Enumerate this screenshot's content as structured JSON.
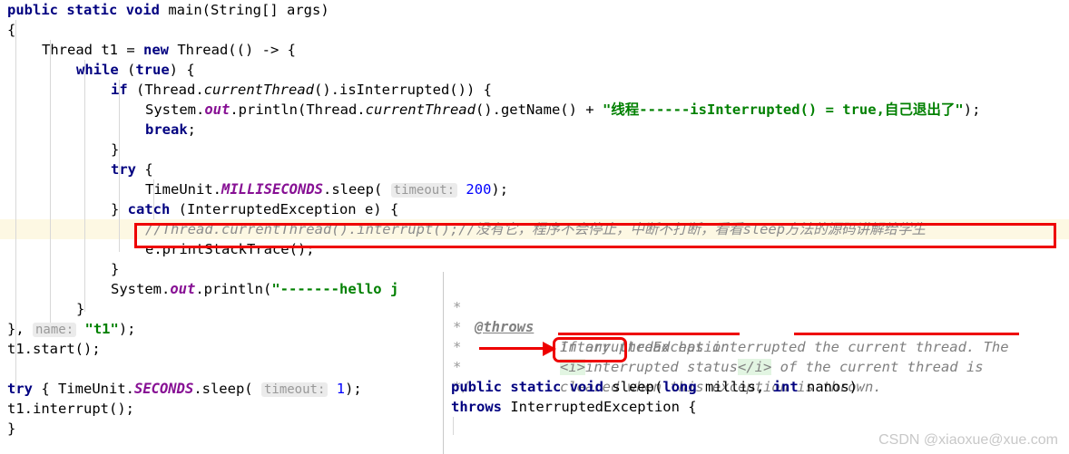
{
  "editor": {
    "language": "java",
    "caret_row_index": 11,
    "lines": [
      {
        "indent": 0,
        "segments": [
          {
            "t": "public",
            "c": "kw"
          },
          {
            "t": " ",
            "c": "plain"
          },
          {
            "t": "static",
            "c": "kw"
          },
          {
            "t": " ",
            "c": "plain"
          },
          {
            "t": "void",
            "c": "kw"
          },
          {
            "t": " main(String[] args)",
            "c": "plain"
          }
        ]
      },
      {
        "indent": 0,
        "segments": [
          {
            "t": "{",
            "c": "plain"
          }
        ]
      },
      {
        "indent": 1,
        "segments": [
          {
            "t": "Thread t1 = ",
            "c": "plain"
          },
          {
            "t": "new",
            "c": "kw"
          },
          {
            "t": " Thread(() -> {",
            "c": "plain"
          }
        ]
      },
      {
        "indent": 2,
        "segments": [
          {
            "t": "while",
            "c": "kw"
          },
          {
            "t": " (",
            "c": "plain"
          },
          {
            "t": "true",
            "c": "kw"
          },
          {
            "t": ") {",
            "c": "plain"
          }
        ]
      },
      {
        "indent": 3,
        "segments": [
          {
            "t": "if",
            "c": "kw"
          },
          {
            "t": " (Thread.",
            "c": "plain"
          },
          {
            "t": "currentThread",
            "c": "ital"
          },
          {
            "t": "().isInterrupted()) {",
            "c": "plain"
          }
        ]
      },
      {
        "indent": 4,
        "segments": [
          {
            "t": "System.",
            "c": "plain"
          },
          {
            "t": "out",
            "c": "stat"
          },
          {
            "t": ".println(Thread.",
            "c": "plain"
          },
          {
            "t": "currentThread",
            "c": "ital"
          },
          {
            "t": "().getName() + ",
            "c": "plain"
          },
          {
            "t": "\"线程------isInterrupted() = true,自己退出了\"",
            "c": "str"
          },
          {
            "t": ");",
            "c": "plain"
          }
        ]
      },
      {
        "indent": 4,
        "segments": [
          {
            "t": "break",
            "c": "kw"
          },
          {
            "t": ";",
            "c": "plain"
          }
        ]
      },
      {
        "indent": 3,
        "segments": [
          {
            "t": "}",
            "c": "plain"
          }
        ]
      },
      {
        "indent": 3,
        "segments": [
          {
            "t": "try",
            "c": "kw"
          },
          {
            "t": " {",
            "c": "plain"
          }
        ]
      },
      {
        "indent": 4,
        "segments": [
          {
            "t": "TimeUnit.",
            "c": "plain"
          },
          {
            "t": "MILLISECONDS",
            "c": "stat"
          },
          {
            "t": ".sleep( ",
            "c": "plain"
          },
          {
            "t": "timeout:",
            "c": "hint"
          },
          {
            "t": " ",
            "c": "plain"
          },
          {
            "t": "200",
            "c": "num"
          },
          {
            "t": ");",
            "c": "plain"
          }
        ]
      },
      {
        "indent": 3,
        "segments": [
          {
            "t": "} ",
            "c": "plain"
          },
          {
            "t": "catch",
            "c": "kw"
          },
          {
            "t": " (InterruptedException e) {",
            "c": "plain"
          }
        ]
      },
      {
        "indent": 4,
        "segments": [
          {
            "t": "//Thread.currentThread().interrupt();//没有它，程序不会停止，中断不打断，看看sleep方法的源码讲解给学生",
            "c": "cmt"
          }
        ]
      },
      {
        "indent": 4,
        "segments": [
          {
            "t": "e.printStackTrace();",
            "c": "plain"
          }
        ]
      },
      {
        "indent": 3,
        "segments": [
          {
            "t": "}",
            "c": "plain"
          }
        ]
      },
      {
        "indent": 3,
        "segments": [
          {
            "t": "System.",
            "c": "plain"
          },
          {
            "t": "out",
            "c": "stat"
          },
          {
            "t": ".println(",
            "c": "plain"
          },
          {
            "t": "\"-------hello j",
            "c": "str"
          }
        ]
      },
      {
        "indent": 2,
        "segments": [
          {
            "t": "}",
            "c": "plain"
          }
        ]
      },
      {
        "indent": 0,
        "segments": [
          {
            "t": "}, ",
            "c": "plain"
          },
          {
            "t": "name:",
            "c": "hint"
          },
          {
            "t": " ",
            "c": "plain"
          },
          {
            "t": "\"t1\"",
            "c": "str"
          },
          {
            "t": ");",
            "c": "plain"
          }
        ]
      },
      {
        "indent": 0,
        "segments": [
          {
            "t": "t1.start();",
            "c": "plain"
          }
        ]
      },
      {
        "indent": 0,
        "segments": [
          {
            "t": "",
            "c": "plain"
          }
        ]
      },
      {
        "indent": 0,
        "segments": [
          {
            "t": "try",
            "c": "kw"
          },
          {
            "t": " { TimeUnit.",
            "c": "plain"
          },
          {
            "t": "SECONDS",
            "c": "stat"
          },
          {
            "t": ".sleep( ",
            "c": "plain"
          },
          {
            "t": "timeout:",
            "c": "hint"
          },
          {
            "t": " ",
            "c": "plain"
          },
          {
            "t": "1",
            "c": "num"
          },
          {
            "t": "); ",
            "c": "plain"
          }
        ]
      },
      {
        "indent": 0,
        "segments": [
          {
            "t": "t1.interrupt();",
            "c": "plain"
          }
        ]
      },
      {
        "indent": -1,
        "segments": [
          {
            "t": "}",
            "c": "plain"
          }
        ]
      }
    ]
  },
  "doc_popup": {
    "throws_tag": "@throws",
    "exception_type": "InterruptedException",
    "lines": [
      {
        "asterisk": "*",
        "pre": "@throws",
        "body": "InterruptedException"
      },
      {
        "asterisk": "*",
        "body": "if any thread has interrupted the current thread. The"
      },
      {
        "asterisk": "*",
        "body": "<i>interrupted status</i> of the current thread is"
      },
      {
        "asterisk": "*",
        "body": "cleared when this exception is thrown."
      },
      {
        "asterisk": "*/",
        "body": ""
      }
    ],
    "line2_text": "if any thread has interrupted the current thread. The",
    "line3_open_tag": "<i>",
    "line3_mid": "interrupted status",
    "line3_close_tag": "</i>",
    "line3_tail": " of the current thread is",
    "line4_highlight": "cleared",
    "line4_tail": " when this exception is thrown.",
    "signature_1": [
      {
        "t": "public",
        "c": "kw"
      },
      {
        "t": " ",
        "c": "plain"
      },
      {
        "t": "static",
        "c": "kw"
      },
      {
        "t": " ",
        "c": "plain"
      },
      {
        "t": "void",
        "c": "kw"
      },
      {
        "t": " sleep(",
        "c": "plain"
      },
      {
        "t": "long",
        "c": "kw"
      },
      {
        "t": " millis, ",
        "c": "plain"
      },
      {
        "t": "int",
        "c": "kw"
      },
      {
        "t": " nanos)",
        "c": "plain"
      }
    ],
    "signature_2": [
      {
        "t": "throws",
        "c": "kw"
      },
      {
        "t": " InterruptedException {",
        "c": "plain"
      }
    ]
  },
  "annotations": {
    "comment_box_label": "commented-interrupt-call",
    "cleared_box_label": "cleared",
    "arrow_label": "points-to-cleared",
    "marker_color": "#ee0000",
    "underline_color": "#ee0000"
  },
  "watermark": {
    "text": "CSDN @xiaoxue@xue.com"
  },
  "colors": {
    "keyword": "#000080",
    "string": "#008000",
    "number": "#0000ff",
    "static_field": "#871094",
    "comment": "#8c8c8c",
    "caret_row": "#fdf8e3",
    "hint_chip_bg": "#ebebeb",
    "tag_highlight": "#e2f5e2",
    "marker": "#ee0000",
    "watermark": "#c8c8c8"
  }
}
